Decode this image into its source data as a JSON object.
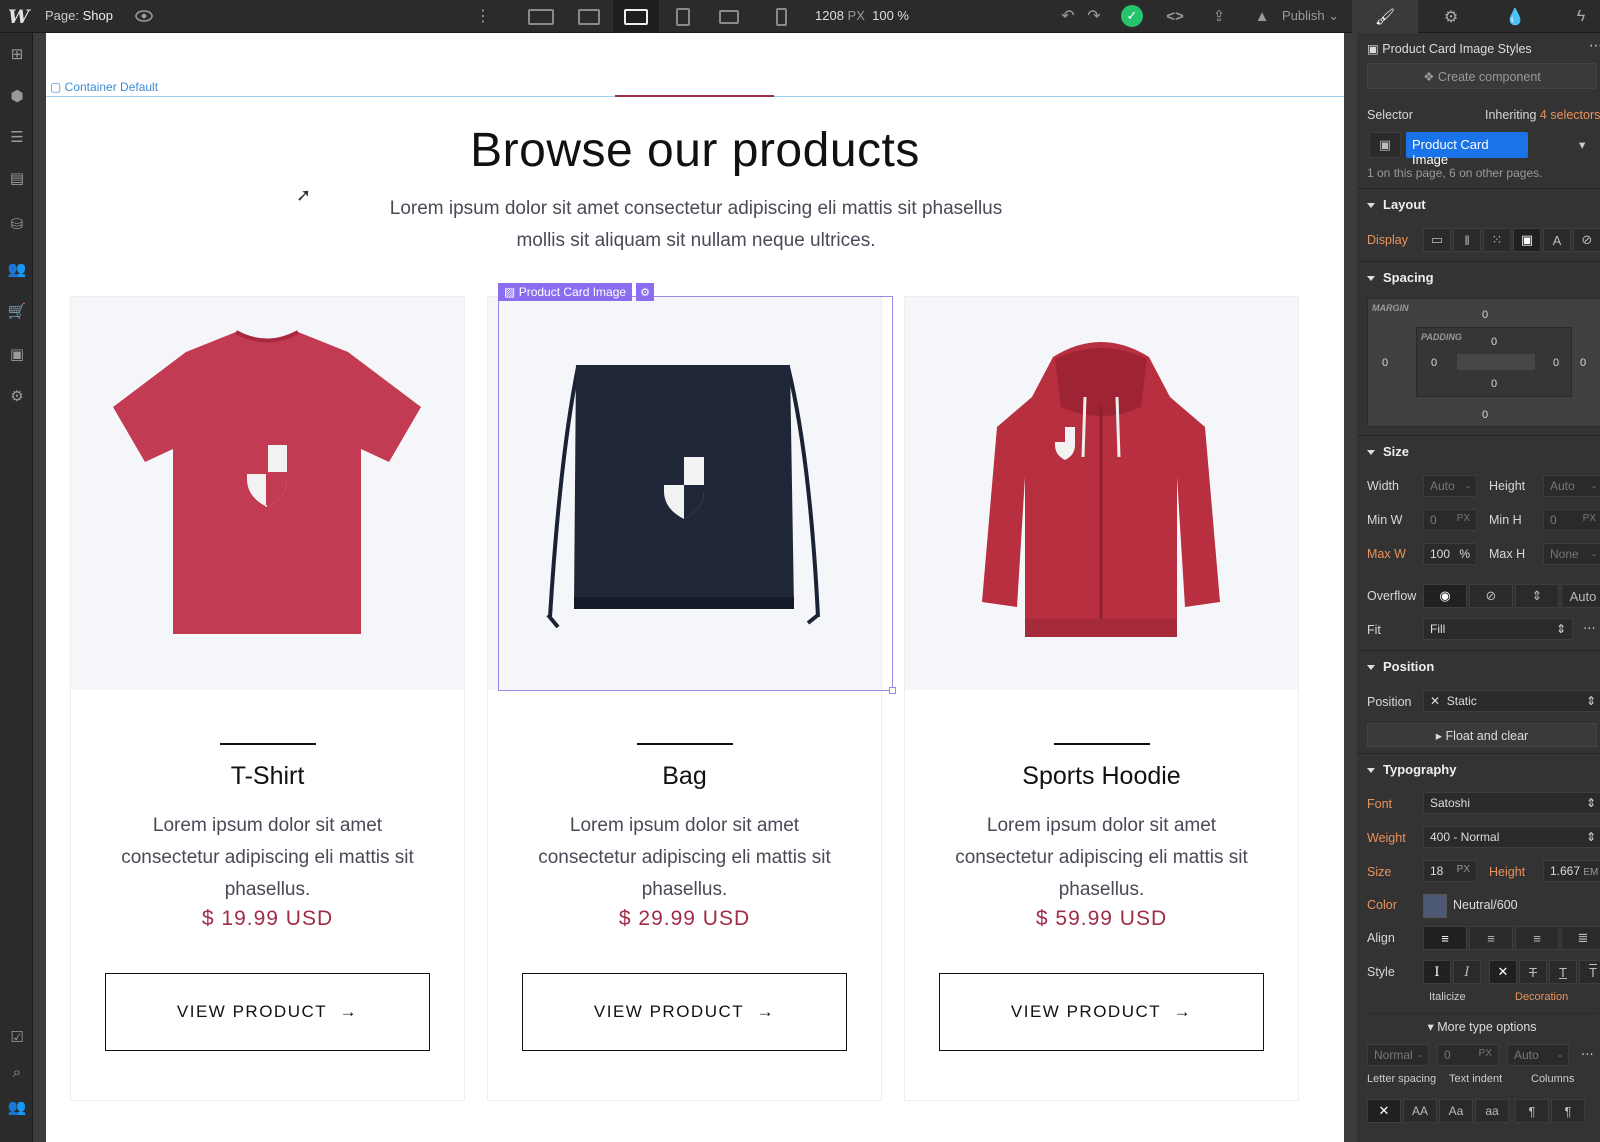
{
  "topbar": {
    "logo": "W",
    "page_prefix": "Page:",
    "page_name": "Shop",
    "width_value": "1208",
    "width_unit": "PX",
    "zoom": "100 %",
    "publish_label": "Publish"
  },
  "canvas": {
    "container_label": "Container Default",
    "heading": "Browse our products",
    "subheading": "Lorem ipsum dolor sit amet consectetur adipiscing eli mattis sit phasellus mollis sit aliquam sit nullam neque ultrices.",
    "selection_tag": "Product Card Image",
    "products": [
      {
        "name": "T-Shirt",
        "desc": "Lorem ipsum dolor sit amet consectetur adipiscing eli mattis sit phasellus.",
        "price": "$ 19.99 USD",
        "button": "VIEW PRODUCT",
        "color": "#c23b52"
      },
      {
        "name": "Bag",
        "desc": "Lorem ipsum dolor sit amet consectetur adipiscing eli mattis sit phasellus.",
        "price": "$ 29.99 USD",
        "button": "VIEW PRODUCT",
        "color": "#1e2638"
      },
      {
        "name": "Sports Hoodie",
        "desc": "Lorem ipsum dolor sit amet consectetur adipiscing eli mattis sit phasellus.",
        "price": "$ 59.99 USD",
        "button": "VIEW PRODUCT",
        "color": "#b8303f"
      }
    ]
  },
  "panel": {
    "title": "Product Card Image Styles",
    "create_component": "Create component",
    "selector_label": "Selector",
    "inheriting_prefix": "Inheriting",
    "inheriting_count": "4 selectors",
    "selector_chip": "Product Card Image",
    "selector_note": "1 on this page, 6 on other pages.",
    "layout": {
      "title": "Layout",
      "display_label": "Display"
    },
    "spacing": {
      "title": "Spacing",
      "margin_label": "MARGIN",
      "padding_label": "PADDING",
      "margin_top": "0",
      "margin_left": "0",
      "margin_right": "0",
      "margin_bottom": "0",
      "padding_top": "0",
      "padding_left": "0",
      "padding_right": "0",
      "padding_bottom": "0"
    },
    "size": {
      "title": "Size",
      "width_label": "Width",
      "width_value": "Auto",
      "width_unit": "-",
      "height_label": "Height",
      "height_value": "Auto",
      "height_unit": "-",
      "minw_label": "Min W",
      "minw_value": "0",
      "minw_unit": "PX",
      "minh_label": "Min H",
      "minh_value": "0",
      "minh_unit": "PX",
      "maxw_label": "Max W",
      "maxw_value": "100",
      "maxw_unit": "%",
      "maxh_label": "Max H",
      "maxh_value": "None",
      "maxh_unit": "-",
      "overflow_label": "Overflow",
      "overflow_auto": "Auto",
      "fit_label": "Fit",
      "fit_value": "Fill"
    },
    "position": {
      "title": "Position",
      "position_label": "Position",
      "position_value": "Static",
      "float_label": "Float and clear"
    },
    "typography": {
      "title": "Typography",
      "font_label": "Font",
      "font_value": "Satoshi",
      "weight_label": "Weight",
      "weight_value": "400 - Normal",
      "size_label": "Size",
      "size_value": "18",
      "size_unit": "PX",
      "height_label": "Height",
      "height_value": "1.667",
      "height_unit": "EM",
      "color_label": "Color",
      "color_value": "Neutral/600",
      "align_label": "Align",
      "style_label": "Style",
      "italicize_label": "Italicize",
      "decoration_label": "Decoration",
      "more_label": "More type options",
      "letter_spacing_value": "Normal",
      "letter_spacing_unit": "-",
      "text_indent_value": "0",
      "text_indent_unit": "PX",
      "columns_value": "Auto",
      "columns_unit": "-",
      "letter_spacing_label": "Letter spacing",
      "text_indent_label": "Text indent",
      "columns_label": "Columns"
    }
  },
  "colors": {
    "accent": "#9b2d45",
    "price": "#a02c47",
    "selection": "#8a6df0",
    "selector_chip": "#1a73e8",
    "status_ok": "#27c46b"
  }
}
